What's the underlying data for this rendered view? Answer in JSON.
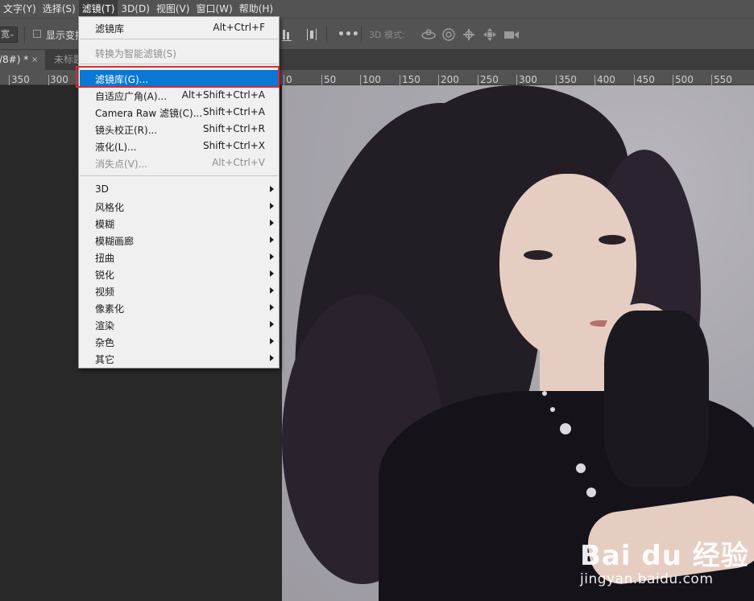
{
  "menubar": {
    "items": [
      {
        "label": "文字(Y)",
        "active": false
      },
      {
        "label": "选择(S)",
        "active": false
      },
      {
        "label": "滤镜(T)",
        "active": true
      },
      {
        "label": "3D(D)",
        "active": false
      },
      {
        "label": "视图(V)",
        "active": false
      },
      {
        "label": "窗口(W)",
        "active": false
      },
      {
        "label": "帮助(H)",
        "active": false
      }
    ]
  },
  "options": {
    "select_value": "宽",
    "show_transform_label": "显示变换控件",
    "more_label": "•••",
    "mode_3d_label": "3D 模式:",
    "icons": [
      "align-bottom-icon",
      "distribute-icon",
      "more-icon",
      "rotate-3d-icon",
      "roll-3d-icon",
      "pan-3d-icon",
      "slide-3d-icon",
      "scale-3d-icon"
    ]
  },
  "tabs": {
    "active_label": "/8#) *",
    "active_close": "×",
    "inactive_label": "未标题"
  },
  "ruler": {
    "labels": [
      "350",
      "300",
      "0",
      "50",
      "100",
      "150",
      "200",
      "250",
      "300",
      "350",
      "400",
      "450",
      "500",
      "550"
    ]
  },
  "filter_menu": {
    "top_items": [
      {
        "label": "滤镜库",
        "shortcut": "Alt+Ctrl+F",
        "disabled": false
      },
      {
        "label": "转换为智能滤镜(S)",
        "shortcut": "",
        "disabled": true
      }
    ],
    "group2": [
      {
        "label": "滤镜库(G)...",
        "shortcut": "",
        "disabled": false,
        "highlight": true
      },
      {
        "label": "自适应广角(A)...",
        "shortcut": "Alt+Shift+Ctrl+A",
        "disabled": false
      },
      {
        "label": "Camera Raw 滤镜(C)...",
        "shortcut": "Shift+Ctrl+A",
        "disabled": false
      },
      {
        "label": "镜头校正(R)...",
        "shortcut": "Shift+Ctrl+R",
        "disabled": false
      },
      {
        "label": "液化(L)...",
        "shortcut": "Shift+Ctrl+X",
        "disabled": false
      },
      {
        "label": "消失点(V)...",
        "shortcut": "Alt+Ctrl+V",
        "disabled": true
      }
    ],
    "submenus": [
      "3D",
      "风格化",
      "模糊",
      "模糊画廊",
      "扭曲",
      "锐化",
      "视频",
      "像素化",
      "渲染",
      "杂色",
      "其它"
    ]
  },
  "watermark": {
    "main": "Bai du 经验",
    "url": "jingyan.baidu.com"
  },
  "colors": {
    "menubar_bg": "#535353",
    "canvas_bg": "#282828",
    "highlight": "#0a78d4",
    "annotation_red": "#e3262c"
  }
}
